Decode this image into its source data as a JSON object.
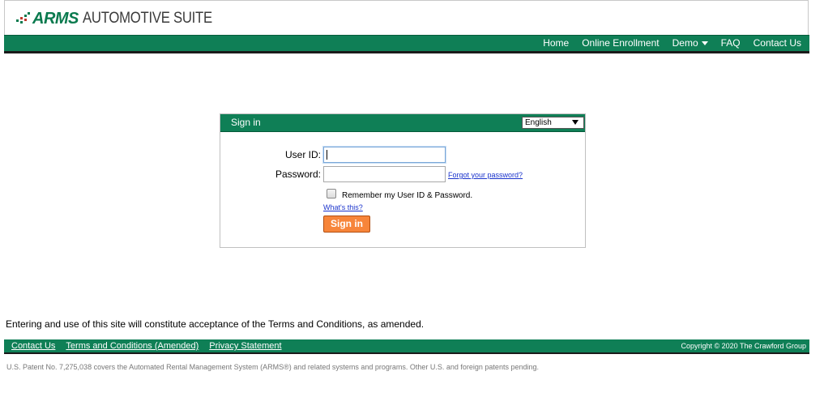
{
  "header": {
    "logo_brand": "ARMS",
    "logo_product": "AUTOMOTIVE SUITE",
    "brand_color": "#0f7f56"
  },
  "nav": {
    "items": [
      {
        "label": "Home"
      },
      {
        "label": "Online Enrollment"
      },
      {
        "label": "Demo"
      },
      {
        "label": "FAQ"
      },
      {
        "label": "Contact Us"
      }
    ]
  },
  "signin": {
    "title": "Sign in",
    "language_selected": "English",
    "user_id_label": "User ID:",
    "user_id_value": "",
    "password_label": "Password:",
    "password_value": "",
    "forgot_password": "Forgot your password?",
    "remember_label": "Remember my User ID & Password.",
    "remember_checked": false,
    "whats_this": "What's this?",
    "submit_label": "Sign in",
    "submit_color": "#f7853a"
  },
  "footer": {
    "terms_notice": "Entering and use of this site will constitute acceptance of the Terms and Conditions, as amended.",
    "links": [
      {
        "label": "Contact Us"
      },
      {
        "label": "Terms and Conditions (Amended)"
      },
      {
        "label": "Privacy Statement"
      }
    ],
    "copyright": "Copyright © 2020 The Crawford Group",
    "patent": "U.S. Patent No. 7,275,038 covers the Automated Rental Management System (ARMS®) and related systems and programs. Other U.S. and foreign patents pending."
  }
}
